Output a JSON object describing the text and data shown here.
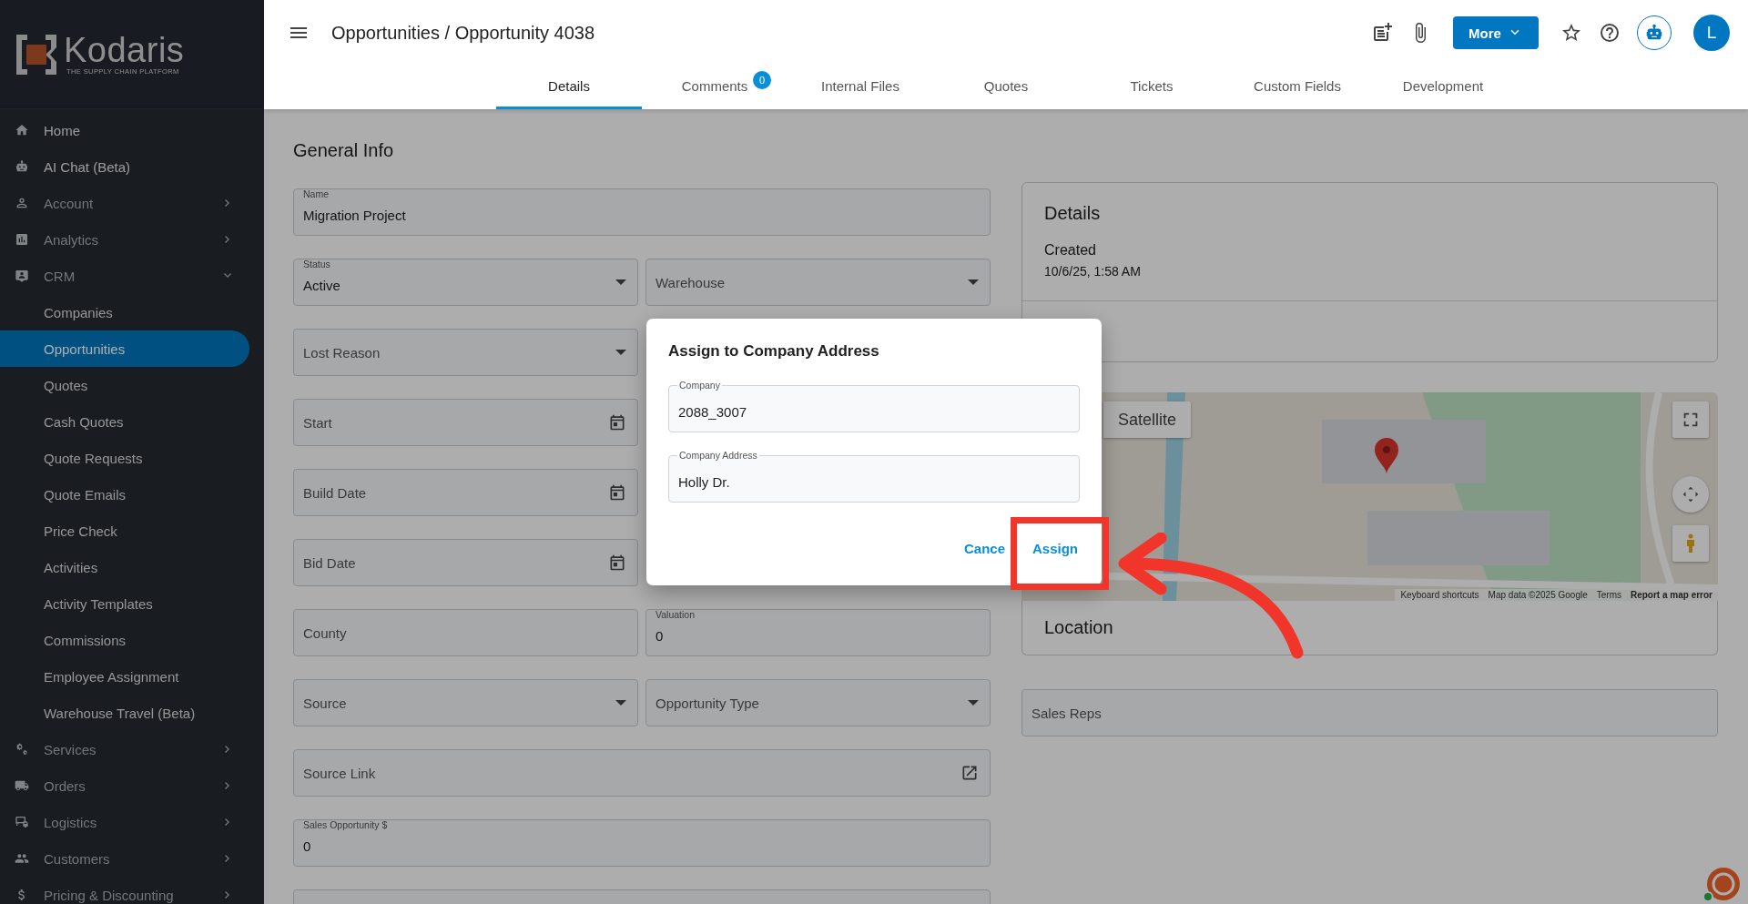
{
  "sidebar": {
    "logo": {
      "name": "Kodaris",
      "tagline": "THE SUPPLY CHAIN PLATFORM"
    },
    "items": [
      {
        "kind": "link",
        "label": "Home"
      },
      {
        "kind": "link",
        "label": "AI Chat (Beta)"
      },
      {
        "kind": "group",
        "label": "Account",
        "expanded": false
      },
      {
        "kind": "group",
        "label": "Analytics",
        "expanded": false
      },
      {
        "kind": "group",
        "label": "CRM",
        "expanded": true,
        "children": [
          {
            "label": "Companies",
            "selected": false
          },
          {
            "label": "Opportunities",
            "selected": true
          },
          {
            "label": "Quotes",
            "selected": false
          },
          {
            "label": "Cash Quotes",
            "selected": false
          },
          {
            "label": "Quote Requests",
            "selected": false
          },
          {
            "label": "Quote Emails",
            "selected": false
          },
          {
            "label": "Price Check",
            "selected": false
          },
          {
            "label": "Activities",
            "selected": false
          },
          {
            "label": "Activity Templates",
            "selected": false
          },
          {
            "label": "Commissions",
            "selected": false
          },
          {
            "label": "Employee Assignment",
            "selected": false
          },
          {
            "label": "Warehouse Travel (Beta)",
            "selected": false
          }
        ]
      },
      {
        "kind": "group",
        "label": "Services",
        "expanded": false
      },
      {
        "kind": "group",
        "label": "Orders",
        "expanded": false
      },
      {
        "kind": "group",
        "label": "Logistics",
        "expanded": false
      },
      {
        "kind": "group",
        "label": "Customers",
        "expanded": false
      },
      {
        "kind": "group",
        "label": "Pricing & Discounting",
        "expanded": false
      }
    ]
  },
  "header": {
    "title": "Opportunities / Opportunity 4038",
    "more_button": "More",
    "avatar": "L"
  },
  "tabs": [
    {
      "label": "Details",
      "selected": true
    },
    {
      "label": "Comments",
      "selected": false,
      "badge": "0"
    },
    {
      "label": "Internal Files",
      "selected": false
    },
    {
      "label": "Quotes",
      "selected": false
    },
    {
      "label": "Tickets",
      "selected": false
    },
    {
      "label": "Custom Fields",
      "selected": false
    },
    {
      "label": "Development",
      "selected": false
    }
  ],
  "general_info": {
    "title": "General Info",
    "rows": [
      [
        {
          "kind": "text",
          "label": "Name",
          "value": "Migration Project",
          "wide": true
        }
      ],
      [
        {
          "kind": "select",
          "label": "Status",
          "value": "Active"
        },
        {
          "kind": "select",
          "placeholder": "Warehouse"
        }
      ],
      [
        {
          "kind": "select",
          "placeholder": "Lost Reason"
        }
      ],
      [
        {
          "kind": "date",
          "placeholder": "Start"
        }
      ],
      [
        {
          "kind": "date",
          "placeholder": "Build Date"
        }
      ],
      [
        {
          "kind": "date",
          "placeholder": "Bid Date"
        }
      ],
      [
        {
          "kind": "text",
          "placeholder": "County"
        },
        {
          "kind": "text",
          "label": "Valuation",
          "value": "0"
        }
      ],
      [
        {
          "kind": "select",
          "placeholder": "Source"
        },
        {
          "kind": "select",
          "placeholder": "Opportunity Type"
        }
      ],
      [
        {
          "kind": "link",
          "placeholder": "Source Link",
          "wide": true
        }
      ],
      [
        {
          "kind": "text",
          "label": "Sales Opportunity $",
          "value": "0",
          "wide": true
        }
      ]
    ]
  },
  "details": {
    "title": "Details",
    "created_label": "Created",
    "created_value": "10/6/25, 1:58 AM"
  },
  "map": {
    "satellite_button": "Satellite",
    "attribution": [
      "Keyboard shortcuts",
      "Map data ©2025 Google",
      "Terms",
      "Report a map error"
    ]
  },
  "location": {
    "title": "Location"
  },
  "sales_reps": {
    "placeholder": "Sales Reps"
  },
  "dialog": {
    "title": "Assign to Company Address",
    "fields": [
      {
        "label": "Company",
        "value": "2088_3007"
      },
      {
        "label": "Company Address",
        "value": "Holly Dr."
      }
    ],
    "cancel_button": "Cance",
    "assign_button": "Assign"
  }
}
